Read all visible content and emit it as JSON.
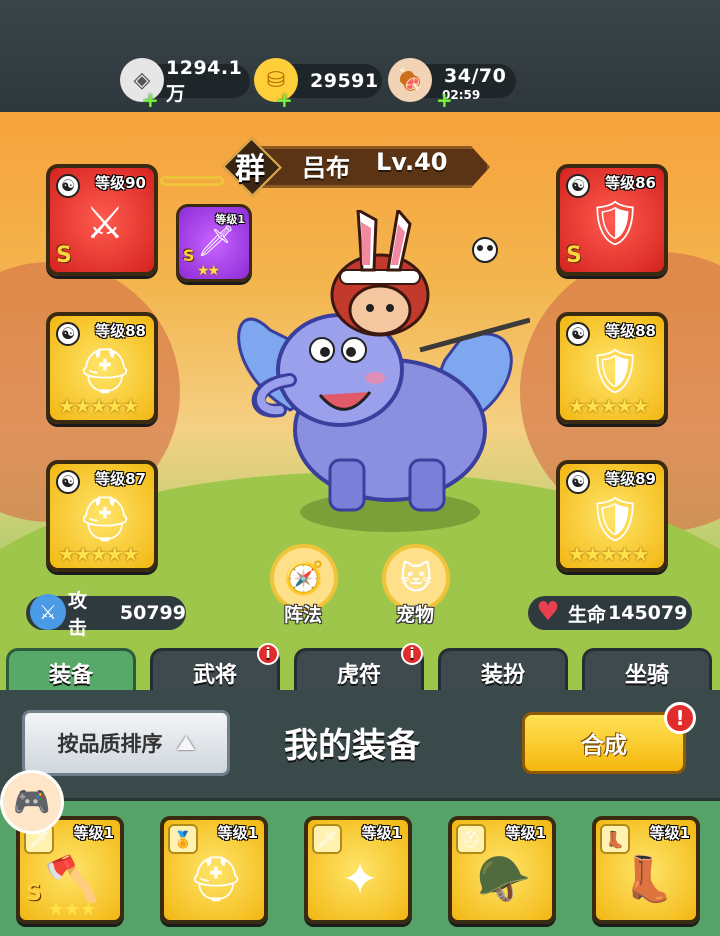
{
  "resources": {
    "silver": {
      "value": "1294.1万",
      "icon": "silver-coin-icon"
    },
    "gold": {
      "value": "29591",
      "icon": "gold-ingot-icon"
    },
    "stamina": {
      "value": "34/70",
      "timer": "02:59",
      "icon": "meat-icon"
    }
  },
  "hero": {
    "faction": "群",
    "name": "吕布",
    "level": "Lv.40"
  },
  "equipped": {
    "left": [
      {
        "level": "等级90",
        "grade": "S",
        "color": "red",
        "icon": "lance-icon"
      },
      {
        "level": "等级88",
        "grade": "",
        "color": "gold",
        "icon": "helmet-icon",
        "stars": "★★★★★"
      },
      {
        "level": "等级87",
        "grade": "",
        "color": "gold",
        "icon": "helmet-icon",
        "stars": "★★★★★"
      }
    ],
    "extra": {
      "level": "等级1",
      "grade": "S",
      "color": "purple",
      "icon": "weapon-icon",
      "stars": "★★"
    },
    "right": [
      {
        "level": "等级86",
        "grade": "S",
        "color": "red",
        "icon": "armor-icon"
      },
      {
        "level": "等级88",
        "grade": "",
        "color": "gold",
        "icon": "armor-icon",
        "stars": "★★★★★"
      },
      {
        "level": "等级89",
        "grade": "",
        "color": "gold",
        "icon": "armor-icon",
        "stars": "★★★★★"
      }
    ]
  },
  "actions": {
    "formation": "阵法",
    "pet": "宠物"
  },
  "stats": {
    "attack_label": "攻击",
    "attack_value": "50799",
    "hp_label": "生命",
    "hp_value": "145079"
  },
  "tabs": [
    {
      "label": "装备",
      "active": true,
      "badge": ""
    },
    {
      "label": "武将",
      "active": false,
      "badge": "i"
    },
    {
      "label": "虎符",
      "active": false,
      "badge": "i"
    },
    {
      "label": "装扮",
      "active": false,
      "badge": ""
    },
    {
      "label": "坐骑",
      "active": false,
      "badge": ""
    }
  ],
  "panel": {
    "sort_label": "按品质排序",
    "title": "我的装备",
    "merge_label": "合成",
    "merge_alert": "!"
  },
  "inventory": [
    {
      "level": "等级1",
      "grade": "S",
      "stars": "★★★",
      "icon": "axe-icon"
    },
    {
      "level": "等级1",
      "grade": "",
      "stars": "",
      "icon": "helmet-icon"
    },
    {
      "level": "等级1",
      "grade": "",
      "stars": "",
      "icon": "shuriken-icon"
    },
    {
      "level": "等级1",
      "grade": "",
      "stars": "",
      "icon": "helmet-icon"
    },
    {
      "level": "等级1",
      "grade": "",
      "stars": "",
      "icon": "boots-icon"
    }
  ],
  "colors": {
    "accent_green": "#56a369",
    "merge_yellow": "#f5b70d",
    "alert_red": "#e22b2b"
  }
}
